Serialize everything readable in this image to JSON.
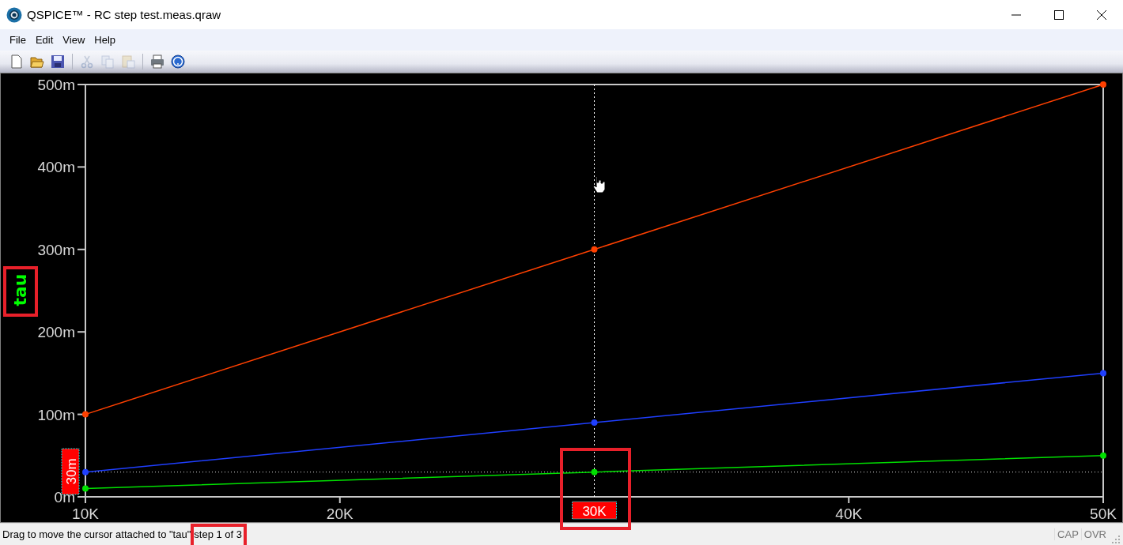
{
  "window": {
    "title": "QSPICE™ - RC step test.meas.qraw"
  },
  "menu": [
    "File",
    "Edit",
    "View",
    "Help"
  ],
  "toolbar": [
    {
      "kind": "new",
      "disabled": false
    },
    {
      "kind": "open",
      "disabled": false
    },
    {
      "kind": "save",
      "disabled": false
    },
    {
      "kind": "separator"
    },
    {
      "kind": "cut",
      "disabled": true
    },
    {
      "kind": "copy",
      "disabled": true
    },
    {
      "kind": "paste",
      "disabled": true
    },
    {
      "kind": "separator"
    },
    {
      "kind": "print",
      "disabled": false
    },
    {
      "kind": "help",
      "disabled": false
    }
  ],
  "plot": {
    "chart_data": {
      "type": "line",
      "ylabel": "tau",
      "x": [
        10000,
        30000,
        50000
      ],
      "xlim": [
        10000,
        50000
      ],
      "ylim": [
        0,
        500
      ],
      "xticks": [
        {
          "value": 10000,
          "label": "10K"
        },
        {
          "value": 20000,
          "label": "20K"
        },
        {
          "value": 40000,
          "label": "40K"
        },
        {
          "value": 50000,
          "label": "50K"
        }
      ],
      "yticks": [
        {
          "value": 0,
          "label": "0m"
        },
        {
          "value": 100,
          "label": "100m"
        },
        {
          "value": 200,
          "label": "200m"
        },
        {
          "value": 300,
          "label": "300m"
        },
        {
          "value": 400,
          "label": "400m"
        },
        {
          "value": 500,
          "label": "500m"
        }
      ],
      "series": [
        {
          "color": "#ff4000",
          "marker": "circle",
          "values": [
            100,
            300,
            500
          ]
        },
        {
          "color": "#1f3fff",
          "marker": "circle",
          "values": [
            30,
            90,
            150
          ]
        },
        {
          "color": "#00e000",
          "marker": "circle",
          "values": [
            10,
            30,
            50
          ]
        }
      ],
      "ref_lines": [
        {
          "axis": "x",
          "value": 30000
        },
        {
          "axis": "y",
          "value": 30
        }
      ],
      "annotations": [
        "30K",
        "30m"
      ]
    }
  },
  "status_bar": {
    "message": "Drag to move the cursor attached to \"tau\"",
    "step": "step 1 of 3",
    "indicators": [
      "CAP",
      "OVR"
    ]
  }
}
